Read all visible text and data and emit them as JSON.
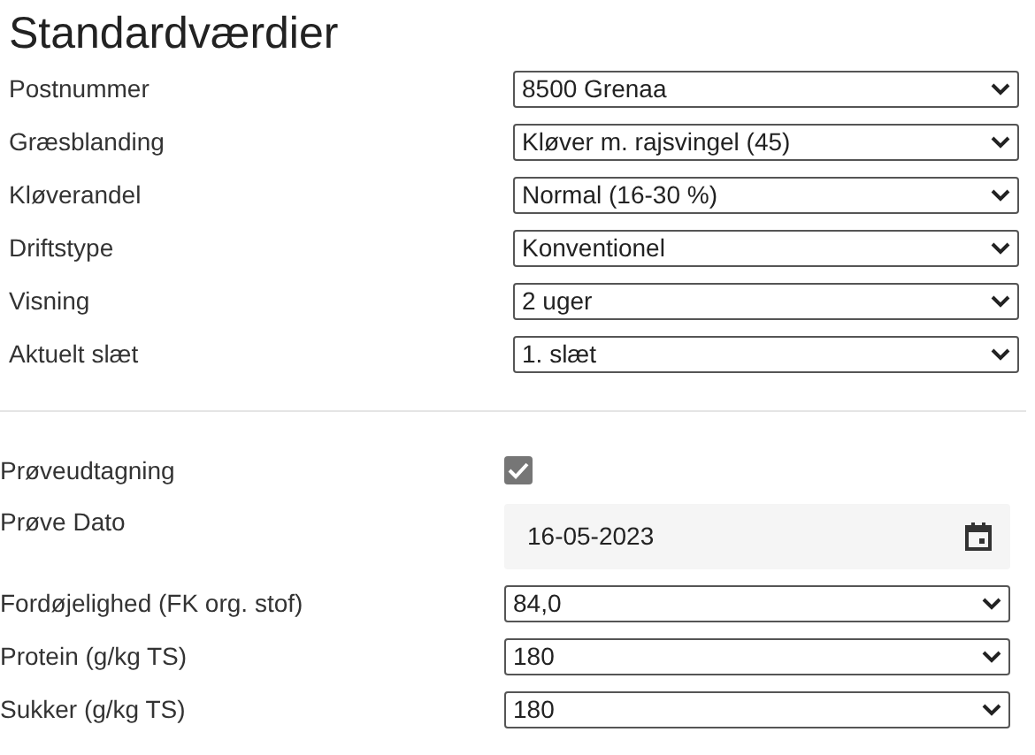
{
  "title": "Standardværdier",
  "sections": [
    {
      "rows": [
        {
          "kind": "select",
          "label": "Postnummer",
          "value": "8500 Grenaa"
        },
        {
          "kind": "select",
          "label": "Græsblanding",
          "value": "Kløver m. rajsvingel (45)"
        },
        {
          "kind": "select",
          "label": "Kløverandel",
          "value": "Normal (16-30 %)"
        },
        {
          "kind": "select",
          "label": "Driftstype",
          "value": "Konventionel"
        },
        {
          "kind": "select",
          "label": "Visning",
          "value": "2 uger"
        },
        {
          "kind": "select",
          "label": "Aktuelt slæt",
          "value": "1. slæt"
        }
      ]
    },
    {
      "rows": [
        {
          "kind": "checkbox",
          "label": "Prøveudtagning",
          "checked": true
        },
        {
          "kind": "date",
          "label": "Prøve Dato",
          "value": "16-05-2023"
        },
        {
          "kind": "select",
          "label": "Fordøjelighed (FK org. stof)",
          "value": "84,0"
        },
        {
          "kind": "select",
          "label": "Protein (g/kg TS)",
          "value": "180"
        },
        {
          "kind": "select",
          "label": "Sukker (g/kg TS)",
          "value": "180"
        }
      ]
    }
  ]
}
